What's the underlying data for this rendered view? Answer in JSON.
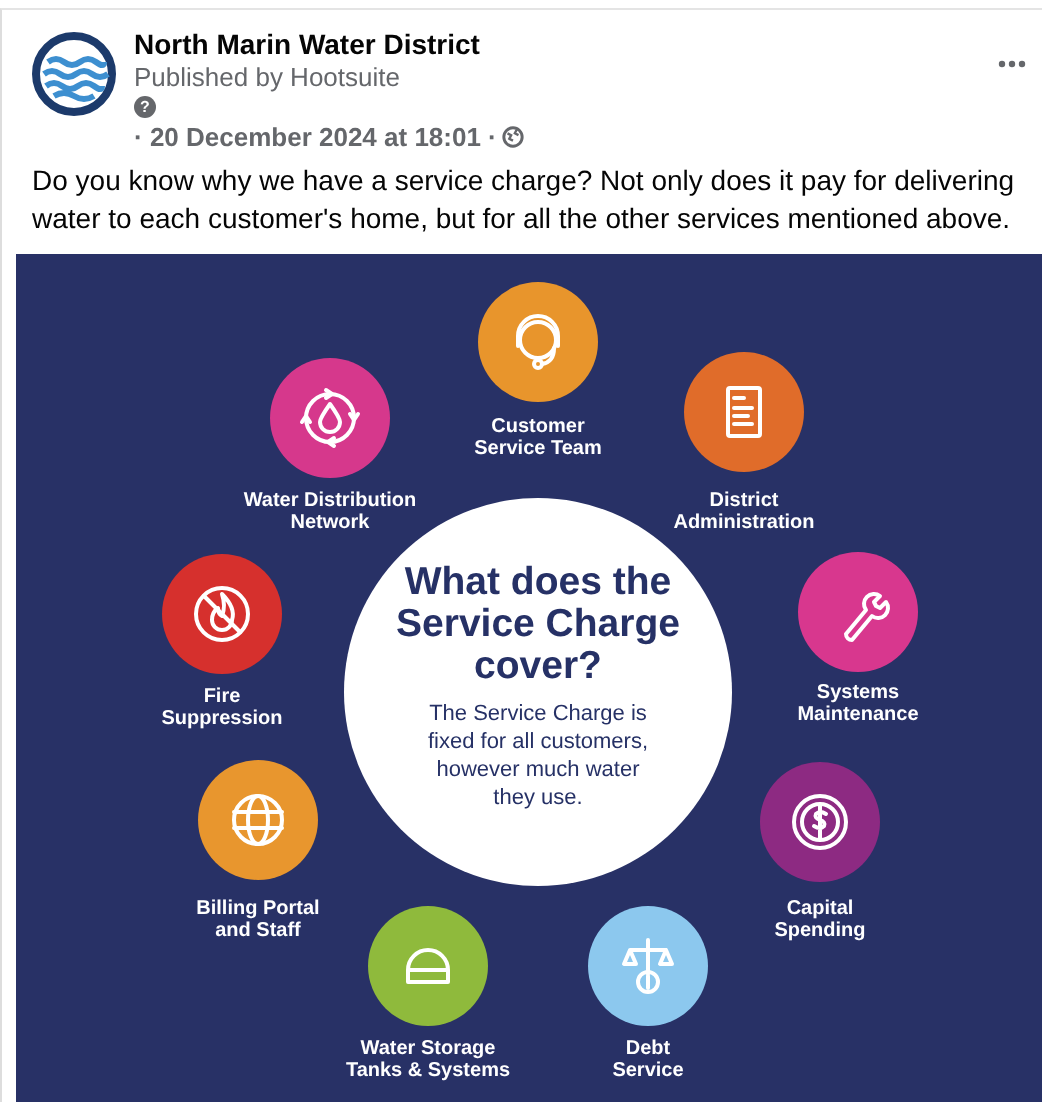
{
  "post": {
    "author": "North Marin Water District",
    "publisher": "Published by Hootsuite",
    "info_mark": "?",
    "timestamp": "· 20 December 2024 at 18:01 ·",
    "text": "Do you know why we have a service charge? Not only does it pay for delivering water to each customer's home, but for all the other services mentioned above."
  },
  "graphic": {
    "title": "What does the Service Charge cover?",
    "subtitle": "The Service Charge is fixed for all customers, however much water they use.",
    "services": [
      {
        "label": "Customer\nService Team",
        "color": "#e8952c"
      },
      {
        "label": "Water Distribution\nNetwork",
        "color": "#d6388c"
      },
      {
        "label": "District\nAdministration",
        "color": "#e06c2a"
      },
      {
        "label": "Fire\nSuppression",
        "color": "#d6302d"
      },
      {
        "label": "Systems\nMaintenance",
        "color": "#d8378e"
      },
      {
        "label": "Billing Portal\nand Staff",
        "color": "#e8962e"
      },
      {
        "label": "Capital\nSpending",
        "color": "#8d2a82"
      },
      {
        "label": "Water Storage\nTanks & Systems",
        "color": "#8fba3c"
      },
      {
        "label": "Debt\nService",
        "color": "#8cc8ee"
      }
    ]
  }
}
